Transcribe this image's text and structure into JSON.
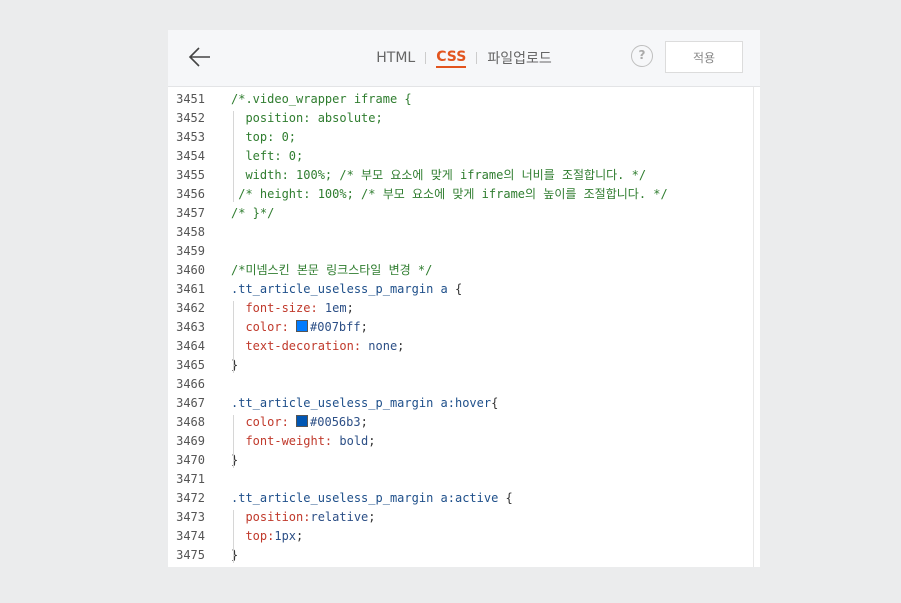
{
  "header": {
    "tabs": [
      {
        "label": "HTML",
        "active": false
      },
      {
        "label": "CSS",
        "active": true
      },
      {
        "label": "파일업로드",
        "active": false
      }
    ],
    "help_label": "?",
    "apply_label": "적용"
  },
  "colors": {
    "accent": "#e2541e",
    "comment": "#2f7d2f",
    "selector": "#1e4f8a",
    "property": "#c0392b",
    "value": "#2c4f86",
    "swatch_1": "#007bff",
    "swatch_2": "#0056b3"
  },
  "editor": {
    "lines": [
      {
        "n": "3451",
        "tokens": [
          {
            "t": "/*.video_wrapper iframe {",
            "c": "comment"
          }
        ]
      },
      {
        "n": "3452",
        "tokens": [
          {
            "t": "  position: absolute;",
            "c": "comment"
          }
        ]
      },
      {
        "n": "3453",
        "tokens": [
          {
            "t": "  top: 0;",
            "c": "comment"
          }
        ]
      },
      {
        "n": "3454",
        "tokens": [
          {
            "t": "  left: 0;",
            "c": "comment"
          }
        ]
      },
      {
        "n": "3455",
        "tokens": [
          {
            "t": "  width: 100%; /* 부모 요소에 맞게 iframe의 너비를 조절합니다. */",
            "c": "comment"
          }
        ]
      },
      {
        "n": "3456",
        "tokens": [
          {
            "t": " /* height: 100%; /* 부모 요소에 맞게 iframe의 높이를 조절합니다. */",
            "c": "comment"
          }
        ]
      },
      {
        "n": "3457",
        "tokens": [
          {
            "t": "/* }*/",
            "c": "comment"
          }
        ]
      },
      {
        "n": "3458",
        "tokens": []
      },
      {
        "n": "3459",
        "tokens": []
      },
      {
        "n": "3460",
        "tokens": [
          {
            "t": "/*미넴스킨 본문 링크스타일 변경 */",
            "c": "comment"
          }
        ]
      },
      {
        "n": "3461",
        "tokens": [
          {
            "t": ".tt_article_useless_p_margin a",
            "c": "sel"
          },
          {
            "t": " {",
            "c": "punc"
          }
        ]
      },
      {
        "n": "3462",
        "tokens": [
          {
            "t": "  font-size:",
            "c": "prop"
          },
          {
            "t": " 1em",
            "c": "val"
          },
          {
            "t": ";",
            "c": "punc"
          }
        ]
      },
      {
        "n": "3463",
        "tokens": [
          {
            "t": "  color:",
            "c": "prop"
          },
          {
            "t": " ",
            "c": "punc"
          },
          {
            "swatch": "#007bff"
          },
          {
            "t": "#007bff",
            "c": "val"
          },
          {
            "t": ";",
            "c": "punc"
          }
        ]
      },
      {
        "n": "3464",
        "tokens": [
          {
            "t": "  text-decoration:",
            "c": "prop"
          },
          {
            "t": " none",
            "c": "val"
          },
          {
            "t": ";",
            "c": "punc"
          }
        ]
      },
      {
        "n": "3465",
        "tokens": [
          {
            "t": "}",
            "c": "punc"
          }
        ]
      },
      {
        "n": "3466",
        "tokens": []
      },
      {
        "n": "3467",
        "tokens": [
          {
            "t": ".tt_article_useless_p_margin a:hover",
            "c": "sel"
          },
          {
            "t": "{",
            "c": "punc"
          }
        ]
      },
      {
        "n": "3468",
        "tokens": [
          {
            "t": "  color:",
            "c": "prop"
          },
          {
            "t": " ",
            "c": "punc"
          },
          {
            "swatch": "#0056b3"
          },
          {
            "t": "#0056b3",
            "c": "val"
          },
          {
            "t": ";",
            "c": "punc"
          }
        ]
      },
      {
        "n": "3469",
        "tokens": [
          {
            "t": "  font-weight:",
            "c": "prop"
          },
          {
            "t": " bold",
            "c": "val"
          },
          {
            "t": ";",
            "c": "punc"
          }
        ]
      },
      {
        "n": "3470",
        "tokens": [
          {
            "t": "}",
            "c": "punc"
          }
        ]
      },
      {
        "n": "3471",
        "tokens": []
      },
      {
        "n": "3472",
        "tokens": [
          {
            "t": ".tt_article_useless_p_margin a:active",
            "c": "sel"
          },
          {
            "t": " {",
            "c": "punc"
          }
        ]
      },
      {
        "n": "3473",
        "tokens": [
          {
            "t": "  position:",
            "c": "prop"
          },
          {
            "t": "relative",
            "c": "val"
          },
          {
            "t": ";",
            "c": "punc"
          }
        ]
      },
      {
        "n": "3474",
        "tokens": [
          {
            "t": "  top:",
            "c": "prop"
          },
          {
            "t": "1px",
            "c": "val"
          },
          {
            "t": ";",
            "c": "punc"
          }
        ]
      },
      {
        "n": "3475",
        "tokens": [
          {
            "t": "}",
            "c": "punc"
          }
        ]
      }
    ]
  }
}
